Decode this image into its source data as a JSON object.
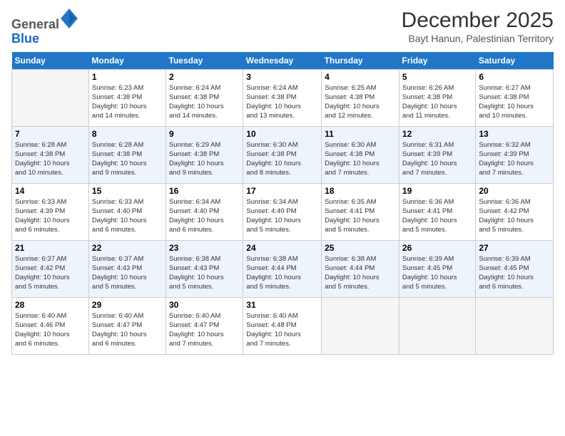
{
  "logo": {
    "general": "General",
    "blue": "Blue"
  },
  "title": "December 2025",
  "subtitle": "Bayt Hanun, Palestinian Territory",
  "days_of_week": [
    "Sunday",
    "Monday",
    "Tuesday",
    "Wednesday",
    "Thursday",
    "Friday",
    "Saturday"
  ],
  "weeks": [
    [
      {
        "day": "",
        "info": ""
      },
      {
        "day": "1",
        "info": "Sunrise: 6:23 AM\nSunset: 4:38 PM\nDaylight: 10 hours\nand 14 minutes."
      },
      {
        "day": "2",
        "info": "Sunrise: 6:24 AM\nSunset: 4:38 PM\nDaylight: 10 hours\nand 14 minutes."
      },
      {
        "day": "3",
        "info": "Sunrise: 6:24 AM\nSunset: 4:38 PM\nDaylight: 10 hours\nand 13 minutes."
      },
      {
        "day": "4",
        "info": "Sunrise: 6:25 AM\nSunset: 4:38 PM\nDaylight: 10 hours\nand 12 minutes."
      },
      {
        "day": "5",
        "info": "Sunrise: 6:26 AM\nSunset: 4:38 PM\nDaylight: 10 hours\nand 11 minutes."
      },
      {
        "day": "6",
        "info": "Sunrise: 6:27 AM\nSunset: 4:38 PM\nDaylight: 10 hours\nand 10 minutes."
      }
    ],
    [
      {
        "day": "7",
        "info": "Sunrise: 6:28 AM\nSunset: 4:38 PM\nDaylight: 10 hours\nand 10 minutes."
      },
      {
        "day": "8",
        "info": "Sunrise: 6:28 AM\nSunset: 4:38 PM\nDaylight: 10 hours\nand 9 minutes."
      },
      {
        "day": "9",
        "info": "Sunrise: 6:29 AM\nSunset: 4:38 PM\nDaylight: 10 hours\nand 9 minutes."
      },
      {
        "day": "10",
        "info": "Sunrise: 6:30 AM\nSunset: 4:38 PM\nDaylight: 10 hours\nand 8 minutes."
      },
      {
        "day": "11",
        "info": "Sunrise: 6:30 AM\nSunset: 4:38 PM\nDaylight: 10 hours\nand 7 minutes."
      },
      {
        "day": "12",
        "info": "Sunrise: 6:31 AM\nSunset: 4:39 PM\nDaylight: 10 hours\nand 7 minutes."
      },
      {
        "day": "13",
        "info": "Sunrise: 6:32 AM\nSunset: 4:39 PM\nDaylight: 10 hours\nand 7 minutes."
      }
    ],
    [
      {
        "day": "14",
        "info": "Sunrise: 6:33 AM\nSunset: 4:39 PM\nDaylight: 10 hours\nand 6 minutes."
      },
      {
        "day": "15",
        "info": "Sunrise: 6:33 AM\nSunset: 4:40 PM\nDaylight: 10 hours\nand 6 minutes."
      },
      {
        "day": "16",
        "info": "Sunrise: 6:34 AM\nSunset: 4:40 PM\nDaylight: 10 hours\nand 6 minutes."
      },
      {
        "day": "17",
        "info": "Sunrise: 6:34 AM\nSunset: 4:40 PM\nDaylight: 10 hours\nand 5 minutes."
      },
      {
        "day": "18",
        "info": "Sunrise: 6:35 AM\nSunset: 4:41 PM\nDaylight: 10 hours\nand 5 minutes."
      },
      {
        "day": "19",
        "info": "Sunrise: 6:36 AM\nSunset: 4:41 PM\nDaylight: 10 hours\nand 5 minutes."
      },
      {
        "day": "20",
        "info": "Sunrise: 6:36 AM\nSunset: 4:42 PM\nDaylight: 10 hours\nand 5 minutes."
      }
    ],
    [
      {
        "day": "21",
        "info": "Sunrise: 6:37 AM\nSunset: 4:42 PM\nDaylight: 10 hours\nand 5 minutes."
      },
      {
        "day": "22",
        "info": "Sunrise: 6:37 AM\nSunset: 4:43 PM\nDaylight: 10 hours\nand 5 minutes."
      },
      {
        "day": "23",
        "info": "Sunrise: 6:38 AM\nSunset: 4:43 PM\nDaylight: 10 hours\nand 5 minutes."
      },
      {
        "day": "24",
        "info": "Sunrise: 6:38 AM\nSunset: 4:44 PM\nDaylight: 10 hours\nand 5 minutes."
      },
      {
        "day": "25",
        "info": "Sunrise: 6:38 AM\nSunset: 4:44 PM\nDaylight: 10 hours\nand 5 minutes."
      },
      {
        "day": "26",
        "info": "Sunrise: 6:39 AM\nSunset: 4:45 PM\nDaylight: 10 hours\nand 5 minutes."
      },
      {
        "day": "27",
        "info": "Sunrise: 6:39 AM\nSunset: 4:45 PM\nDaylight: 10 hours\nand 6 minutes."
      }
    ],
    [
      {
        "day": "28",
        "info": "Sunrise: 6:40 AM\nSunset: 4:46 PM\nDaylight: 10 hours\nand 6 minutes."
      },
      {
        "day": "29",
        "info": "Sunrise: 6:40 AM\nSunset: 4:47 PM\nDaylight: 10 hours\nand 6 minutes."
      },
      {
        "day": "30",
        "info": "Sunrise: 6:40 AM\nSunset: 4:47 PM\nDaylight: 10 hours\nand 7 minutes."
      },
      {
        "day": "31",
        "info": "Sunrise: 6:40 AM\nSunset: 4:48 PM\nDaylight: 10 hours\nand 7 minutes."
      },
      {
        "day": "",
        "info": ""
      },
      {
        "day": "",
        "info": ""
      },
      {
        "day": "",
        "info": ""
      }
    ]
  ]
}
